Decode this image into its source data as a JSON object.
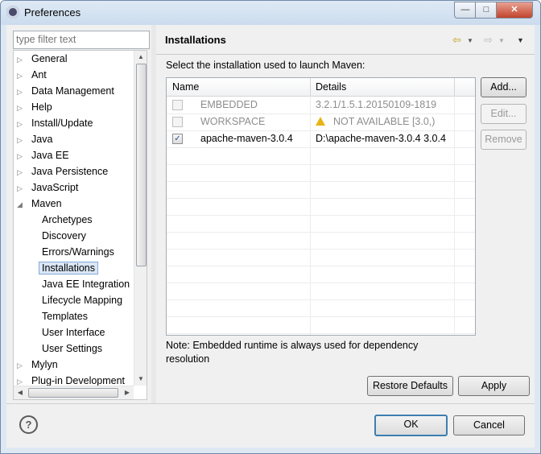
{
  "window": {
    "title": "Preferences",
    "min_icon": "minimize-icon",
    "max_icon": "maximize-icon",
    "close_icon": "close-icon"
  },
  "filter": {
    "placeholder": "type filter text"
  },
  "tree": {
    "items": [
      {
        "label": "General",
        "expander": "collapsed"
      },
      {
        "label": "Ant",
        "expander": "collapsed"
      },
      {
        "label": "Data Management",
        "expander": "collapsed"
      },
      {
        "label": "Help",
        "expander": "collapsed"
      },
      {
        "label": "Install/Update",
        "expander": "collapsed"
      },
      {
        "label": "Java",
        "expander": "collapsed"
      },
      {
        "label": "Java EE",
        "expander": "collapsed"
      },
      {
        "label": "Java Persistence",
        "expander": "collapsed"
      },
      {
        "label": "JavaScript",
        "expander": "collapsed"
      },
      {
        "label": "Maven",
        "expander": "expanded"
      },
      {
        "label": "Archetypes",
        "expander": "none"
      },
      {
        "label": "Discovery",
        "expander": "none"
      },
      {
        "label": "Errors/Warnings",
        "expander": "none"
      },
      {
        "label": "Installations",
        "expander": "none",
        "selected": true
      },
      {
        "label": "Java EE Integration",
        "expander": "none"
      },
      {
        "label": "Lifecycle Mapping",
        "expander": "none"
      },
      {
        "label": "Templates",
        "expander": "none"
      },
      {
        "label": "User Interface",
        "expander": "none"
      },
      {
        "label": "User Settings",
        "expander": "none"
      },
      {
        "label": "Mylyn",
        "expander": "collapsed"
      },
      {
        "label": "Plug-in Development",
        "expander": "collapsed"
      }
    ]
  },
  "page": {
    "title": "Installations",
    "instruction": "Select the installation used to launch Maven:",
    "columns": [
      "Name",
      "Details"
    ],
    "rows": [
      {
        "checked": false,
        "enabled": false,
        "name": "EMBEDDED",
        "details": "3.2.1/1.5.1.20150109-1819",
        "warning": false
      },
      {
        "checked": false,
        "enabled": false,
        "name": "WORKSPACE",
        "details": "NOT AVAILABLE [3.0,)",
        "warning": true
      },
      {
        "checked": true,
        "enabled": true,
        "name": "apache-maven-3.0.4",
        "details": "D:\\apache-maven-3.0.4 3.0.4",
        "warning": false
      }
    ],
    "buttons": {
      "add": "Add...",
      "edit": "Edit...",
      "remove": "Remove"
    },
    "note": "Note: Embedded runtime is always used for dependency resolution",
    "restore_defaults": "Restore Defaults",
    "apply": "Apply"
  },
  "footer": {
    "help": "?",
    "ok": "OK",
    "cancel": "Cancel"
  },
  "icons": {
    "back": "back-arrow-icon",
    "forward": "forward-arrow-icon",
    "menu": "view-menu-icon",
    "warning": "warning-icon"
  }
}
